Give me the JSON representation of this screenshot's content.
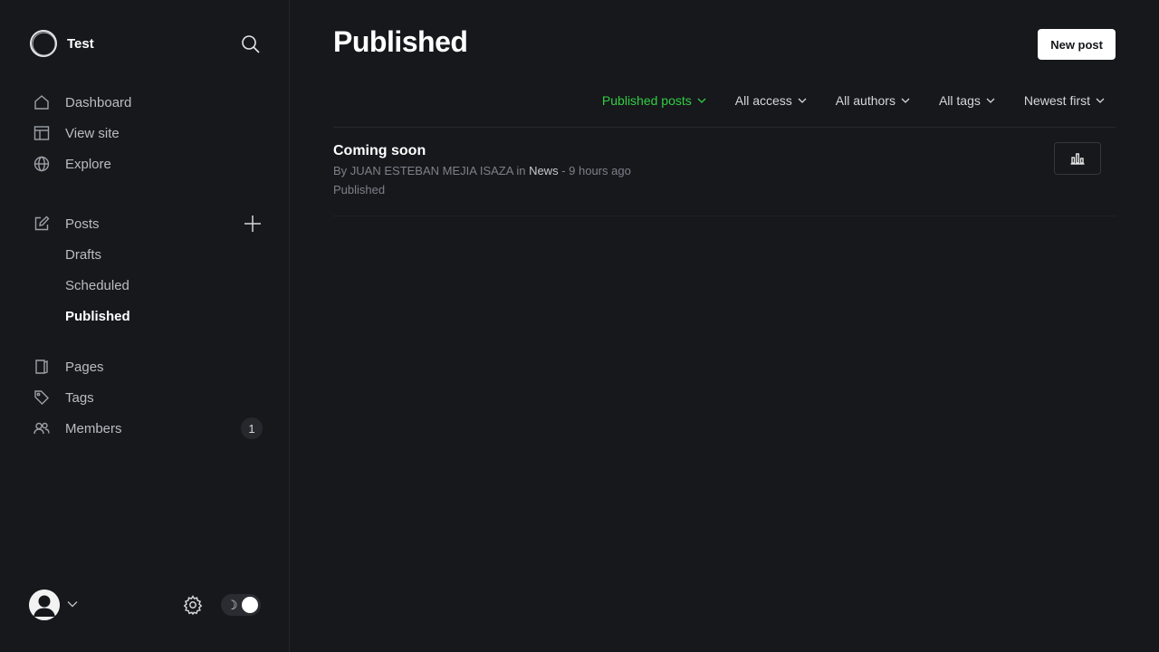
{
  "sidebar": {
    "site_name": "Test",
    "nav": {
      "dashboard": "Dashboard",
      "view_site": "View site",
      "explore": "Explore",
      "posts": "Posts",
      "drafts": "Drafts",
      "scheduled": "Scheduled",
      "published": "Published",
      "pages": "Pages",
      "tags": "Tags",
      "members": "Members",
      "members_count": "1"
    },
    "toggle_moon": "☽"
  },
  "header": {
    "title": "Published",
    "new_post_label": "New post"
  },
  "filters": {
    "type": "Published posts",
    "access": "All access",
    "authors": "All authors",
    "tags": "All tags",
    "order": "Newest first"
  },
  "posts": [
    {
      "title": "Coming soon",
      "by": "By",
      "author": "JUAN ESTEBAN MEJIA ISAZA",
      "in": "in",
      "tag": "News",
      "time": "- 9 hours ago",
      "status": "Published"
    }
  ],
  "colors": {
    "background": "#17181c",
    "accent_green": "#30cf43",
    "text_primary": "#ffffff",
    "text_muted": "#7c8088"
  }
}
